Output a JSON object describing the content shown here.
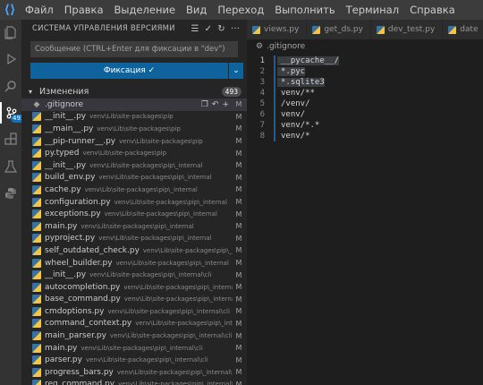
{
  "menu": [
    "Файл",
    "Правка",
    "Выделение",
    "Вид",
    "Переход",
    "Выполнить",
    "Терминал",
    "Справка"
  ],
  "activity": {
    "scm_badge": "493"
  },
  "sidebar": {
    "title": "СИСТЕМА УПРАВЛЕНИЯ ВЕРСИЯМИ",
    "commit_placeholder": "Сообщение (CTRL+Enter для фиксации в \"dev\")",
    "commit_label": "Фиксация ✓",
    "changes_label": "Изменения",
    "changes_count": "493",
    "files": [
      {
        "name": ".gitignore",
        "path": "",
        "status": "M",
        "icon": "git"
      },
      {
        "name": "__init__.py",
        "path": "venv\\Lib\\site-packages\\pip",
        "status": "M",
        "icon": "py"
      },
      {
        "name": "__main__.py",
        "path": "venv\\Lib\\site-packages\\pip",
        "status": "M",
        "icon": "py"
      },
      {
        "name": "__pip-runner__.py",
        "path": "venv\\Lib\\site-packages\\pip",
        "status": "M",
        "icon": "py"
      },
      {
        "name": "py.typed",
        "path": "venv\\Lib\\site-packages\\pip",
        "status": "M",
        "icon": "py"
      },
      {
        "name": "__init__.py",
        "path": "venv\\Lib\\site-packages\\pip\\_internal",
        "status": "M",
        "icon": "py"
      },
      {
        "name": "build_env.py",
        "path": "venv\\Lib\\site-packages\\pip\\_internal",
        "status": "M",
        "icon": "py"
      },
      {
        "name": "cache.py",
        "path": "venv\\Lib\\site-packages\\pip\\_internal",
        "status": "M",
        "icon": "py"
      },
      {
        "name": "configuration.py",
        "path": "venv\\Lib\\site-packages\\pip\\_internal",
        "status": "M",
        "icon": "py"
      },
      {
        "name": "exceptions.py",
        "path": "venv\\Lib\\site-packages\\pip\\_internal",
        "status": "M",
        "icon": "py"
      },
      {
        "name": "main.py",
        "path": "venv\\Lib\\site-packages\\pip\\_internal",
        "status": "M",
        "icon": "py"
      },
      {
        "name": "pyproject.py",
        "path": "venv\\Lib\\site-packages\\pip\\_internal",
        "status": "M",
        "icon": "py"
      },
      {
        "name": "self_outdated_check.py",
        "path": "venv\\Lib\\site-packages\\pip\\_internal",
        "status": "M",
        "icon": "py"
      },
      {
        "name": "wheel_builder.py",
        "path": "venv\\Lib\\site-packages\\pip\\_internal",
        "status": "M",
        "icon": "py"
      },
      {
        "name": "__init__.py",
        "path": "venv\\Lib\\site-packages\\pip\\_internal\\cli",
        "status": "M",
        "icon": "py"
      },
      {
        "name": "autocompletion.py",
        "path": "venv\\Lib\\site-packages\\pip\\_internal\\cli",
        "status": "M",
        "icon": "py"
      },
      {
        "name": "base_command.py",
        "path": "venv\\Lib\\site-packages\\pip\\_internal\\cli",
        "status": "M",
        "icon": "py"
      },
      {
        "name": "cmdoptions.py",
        "path": "venv\\Lib\\site-packages\\pip\\_internal\\cli",
        "status": "M",
        "icon": "py"
      },
      {
        "name": "command_context.py",
        "path": "venv\\Lib\\site-packages\\pip\\_internal\\cli",
        "status": "M",
        "icon": "py"
      },
      {
        "name": "main_parser.py",
        "path": "venv\\Lib\\site-packages\\pip\\_internal\\cli",
        "status": "M",
        "icon": "py"
      },
      {
        "name": "main.py",
        "path": "venv\\Lib\\site-packages\\pip\\_internal\\cli",
        "status": "M",
        "icon": "py"
      },
      {
        "name": "parser.py",
        "path": "venv\\Lib\\site-packages\\pip\\_internal\\cli",
        "status": "M",
        "icon": "py"
      },
      {
        "name": "progress_bars.py",
        "path": "venv\\Lib\\site-packages\\pip\\_internal\\cli",
        "status": "M",
        "icon": "py"
      },
      {
        "name": "req_command.py",
        "path": "venv\\Lib\\site-packages\\pip\\_internal\\cli",
        "status": "M",
        "icon": "py"
      }
    ]
  },
  "editor": {
    "tabs": [
      "views.py",
      "get_ds.py",
      "dev_test.py",
      "date"
    ],
    "breadcrumb": ".gitignore",
    "lines": [
      {
        "n": "1",
        "text": "__pycache__/",
        "hl": true
      },
      {
        "n": "2",
        "text": "*.pyc",
        "hl": true
      },
      {
        "n": "3",
        "text": "*.sqlite3",
        "hl": true
      },
      {
        "n": "4",
        "text": "venv/**",
        "hl": false
      },
      {
        "n": "5",
        "text": "/venv/",
        "hl": false
      },
      {
        "n": "6",
        "text": "venv/",
        "hl": false
      },
      {
        "n": "7",
        "text": "venv/*.*",
        "hl": false
      },
      {
        "n": "8",
        "text": "venv/*",
        "hl": false
      }
    ]
  },
  "colors": {
    "accent": "#0e639c",
    "badge": "#0e70c0"
  }
}
